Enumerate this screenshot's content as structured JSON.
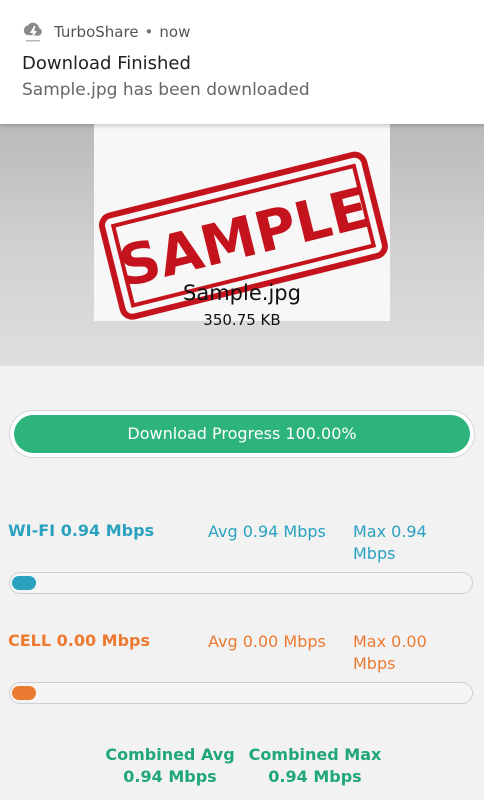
{
  "notification": {
    "app_name": "TurboShare",
    "separator": "•",
    "time": "now",
    "title": "Download Finished",
    "body": "Sample.jpg has been downloaded",
    "icon": "turboshare-app-icon"
  },
  "preview": {
    "stamp_text": "SAMPLE",
    "file_name": "Sample.jpg",
    "file_size": "350.75 KB"
  },
  "progress": {
    "label": "Download Progress 100.00%",
    "fraction": 1.0,
    "color": "#2db37c"
  },
  "wifi": {
    "label": "WI-FI 0.94 Mbps",
    "avg": "Avg 0.94 Mbps",
    "max": "Max 0.94 Mbps",
    "bar_fraction": 0.04,
    "color": "#2aa1bf"
  },
  "cell": {
    "label": "CELL 0.00 Mbps",
    "avg": "Avg 0.00 Mbps",
    "max": "Max 0.00 Mbps",
    "bar_fraction": 0.04,
    "color": "#ec7a31"
  },
  "combined": {
    "avg_label": "Combined Avg",
    "avg_value": "0.94 Mbps",
    "max_label": "Combined Max",
    "max_value": "0.94 Mbps",
    "color": "#20a779"
  }
}
